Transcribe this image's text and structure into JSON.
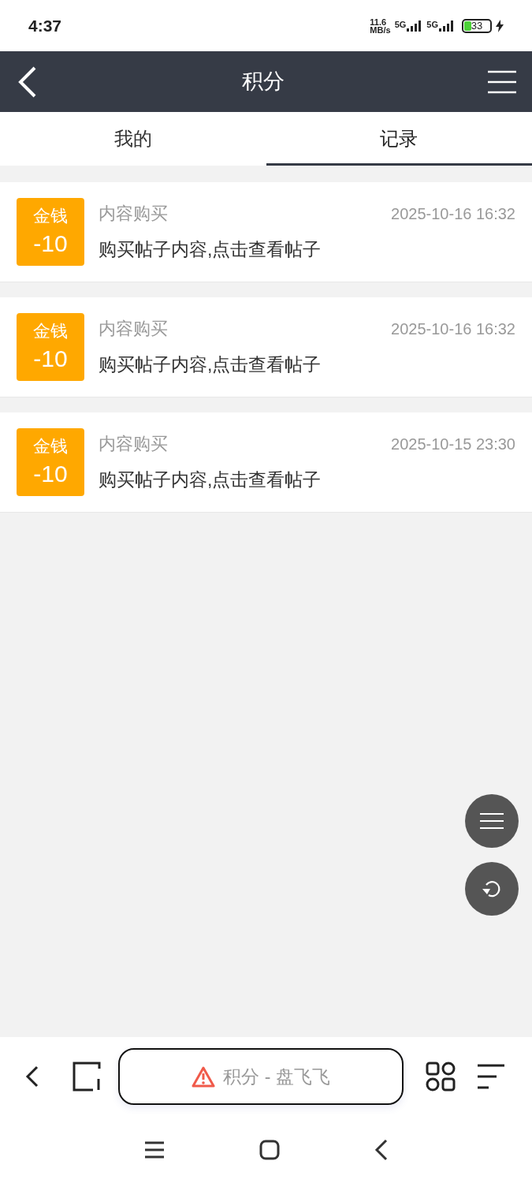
{
  "status_bar": {
    "time": "4:37",
    "speed_value": "11.6",
    "speed_unit": "MB/s",
    "network_1": "5G",
    "network_2": "5G",
    "battery": "33"
  },
  "header": {
    "title": "积分"
  },
  "tabs": [
    {
      "label": "我的",
      "selected": false
    },
    {
      "label": "记录",
      "selected": true
    }
  ],
  "records": [
    {
      "badge_label": "金钱",
      "badge_amount": "-10",
      "category": "内容购买",
      "time": "2025-10-16 16:32",
      "description": "购买帖子内容,点击查看帖子"
    },
    {
      "badge_label": "金钱",
      "badge_amount": "-10",
      "category": "内容购买",
      "time": "2025-10-16 16:32",
      "description": "购买帖子内容,点击查看帖子"
    },
    {
      "badge_label": "金钱",
      "badge_amount": "-10",
      "category": "内容购买",
      "time": "2025-10-15 23:30",
      "description": "购买帖子内容,点击查看帖子"
    }
  ],
  "browser_bar": {
    "address": "积分 - 盘飞飞"
  }
}
